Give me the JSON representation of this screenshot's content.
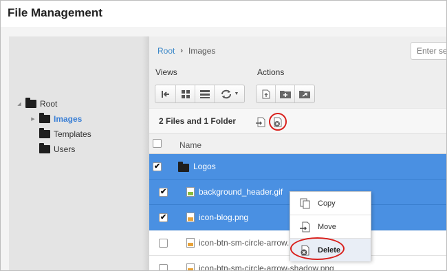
{
  "app": {
    "title": "File Management"
  },
  "tree": [
    {
      "label": "Root",
      "expanded": true,
      "level": 0
    },
    {
      "label": "Images",
      "selected": true,
      "level": 1,
      "has_children": true
    },
    {
      "label": "Templates",
      "level": 1
    },
    {
      "label": "Users",
      "level": 1
    }
  ],
  "breadcrumb": {
    "root": "Root",
    "separator": "›",
    "current": "Images"
  },
  "search": {
    "placeholder": "Enter se"
  },
  "toolbar": {
    "views_label": "Views",
    "actions_label": "Actions",
    "view_buttons": [
      "collapse-panel-icon",
      "grid-view-icon",
      "list-view-icon",
      "refresh-icon"
    ],
    "action_buttons": [
      "upload-file-icon",
      "new-folder-icon",
      "folder-action-icon"
    ]
  },
  "summary": {
    "text": "2 Files and 1 Folder"
  },
  "table": {
    "header": {
      "name": "Name"
    },
    "rows": [
      {
        "name": "Logos",
        "type": "folder",
        "checked": true,
        "selected": true
      },
      {
        "name": "background_header.gif",
        "type": "gif",
        "checked": true,
        "selected": true
      },
      {
        "name": "icon-blog.png",
        "type": "png",
        "checked": true,
        "selected": true
      },
      {
        "name": "icon-btn-sm-circle-arrow.png",
        "type": "png",
        "checked": false,
        "selected": false
      },
      {
        "name": "icon-btn-sm-circle-arrow-shadow.png",
        "type": "png",
        "checked": false,
        "selected": false
      }
    ]
  },
  "context_menu": {
    "items": [
      {
        "label": "Copy",
        "icon": "copy-icon"
      },
      {
        "label": "Move",
        "icon": "move-icon"
      },
      {
        "label": "Delete",
        "icon": "delete-icon",
        "highlighted": true
      }
    ]
  },
  "colors": {
    "selection": "#4a90e2",
    "link": "#3a87c8",
    "annotation": "#d9201c",
    "sidebar_bg": "#e4e4e4"
  }
}
